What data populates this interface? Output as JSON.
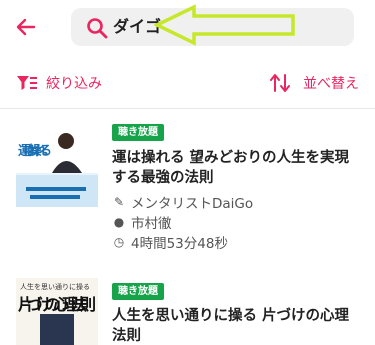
{
  "search": {
    "query": "ダイゴ"
  },
  "toolbar": {
    "filter_label": "絞り込み",
    "sort_label": "並べ替え"
  },
  "results": [
    {
      "badge": "聴き放題",
      "title": "運は操れる 望みどおりの人生を実現する最強の法則",
      "author": "メンタリストDaiGo",
      "narrator": "市村徹",
      "duration": "4時間53分48秒",
      "cover_text": "運は操れる"
    },
    {
      "badge": "聴き放題",
      "title": "人生を思い通りに操る 片づけの心理法則",
      "cover_caption": "人生を思い通りに操る",
      "cover_text": "片づけの心理法則"
    }
  ],
  "colors": {
    "accent": "#e8265f",
    "badge": "#17a34a",
    "annotation_arrow": "#c6e82a"
  }
}
